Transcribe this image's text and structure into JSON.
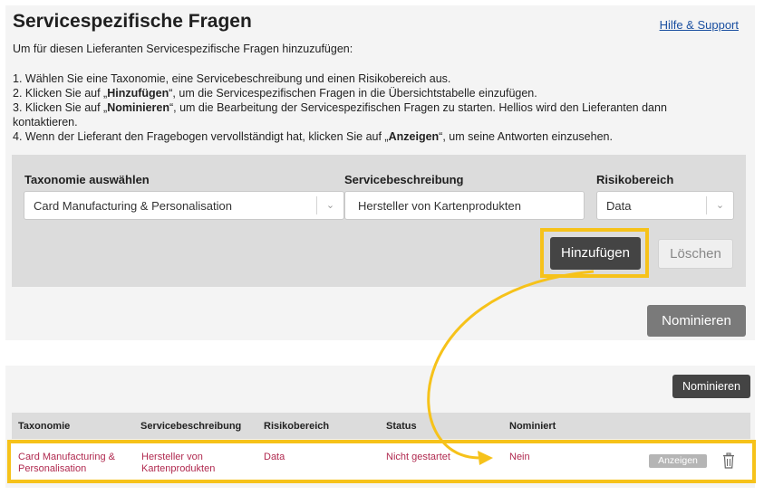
{
  "header": {
    "title": "Servicespezifische Fragen",
    "help_link": "Hilfe & Support"
  },
  "intro": "Um für diesen Lieferanten Servicespezifische Fragen hinzuzufügen:",
  "steps": {
    "s1": "1. Wählen Sie eine Taxonomie, eine Servicebeschreibung und einen Risikobereich aus.",
    "s2_pre": "2. Klicken Sie auf „",
    "s2_bold": "Hinzufügen",
    "s2_post": "“, um die Servicespezifischen Fragen in die Übersichtstabelle einzufügen.",
    "s3_pre": "3. Klicken Sie auf „",
    "s3_bold": "Nominieren",
    "s3_post": "“, um die Bearbeitung der Servicespezifischen Fragen zu starten. Hellios wird den Lieferanten dann kontaktieren.",
    "s4_pre": "4. Wenn der Lieferant den Fragebogen vervollständigt hat, klicken Sie auf „",
    "s4_bold": "Anzeigen",
    "s4_post": "“, um seine Antworten einzusehen."
  },
  "form": {
    "taxonomy_label": "Taxonomie auswählen",
    "taxonomy_value": "Card Manufacturing & Personalisation",
    "service_label": "Servicebeschreibung",
    "service_value": "Hersteller von Kartenprodukten",
    "risk_label": "Risikobereich",
    "risk_value": "Data",
    "add_button": "Hinzufügen",
    "clear_button": "Löschen",
    "nominate_button": "Nominieren"
  },
  "table": {
    "nominate_button": "Nominieren",
    "headers": [
      "Taxonomie",
      "Servicebeschreibung",
      "Risikobereich",
      "Status",
      "Nominiert"
    ],
    "rows": [
      {
        "taxonomy_line1": "Card Manufacturing &",
        "taxonomy_line2": "Personalisation",
        "service_line1": "Hersteller von",
        "service_line2": "Kartenprodukten",
        "risk": "Data",
        "status": "Nicht gestartet",
        "nominated": "Nein",
        "view_button": "Anzeigen"
      }
    ]
  },
  "icons": {
    "chevron": "chevron-down-icon",
    "delete": "trash-icon"
  },
  "colors": {
    "highlight": "#f6c21a",
    "row_text": "#b0294f",
    "primary_button": "#444444",
    "link": "#1a4fa0"
  }
}
